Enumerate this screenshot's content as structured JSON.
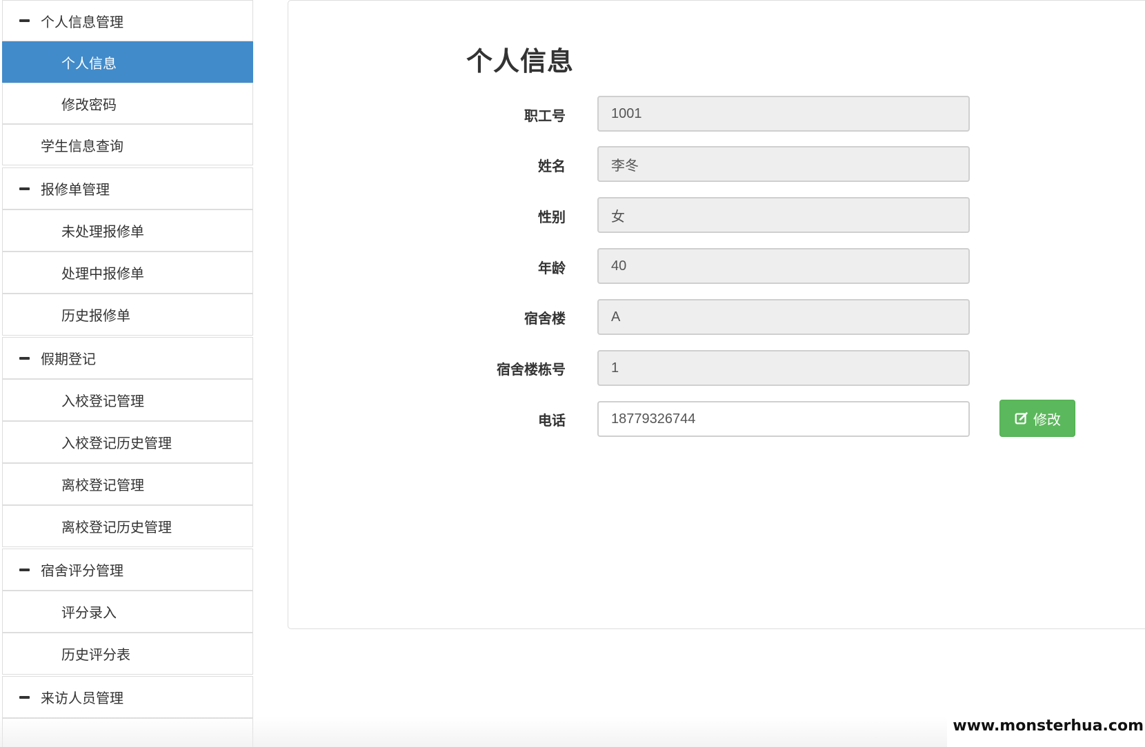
{
  "sidebar": {
    "items": [
      {
        "label": "个人信息管理",
        "kind": "group"
      },
      {
        "label": "个人信息",
        "kind": "sub",
        "active": true
      },
      {
        "label": "修改密码",
        "kind": "sub"
      },
      {
        "label": "学生信息查询",
        "kind": "plain"
      },
      {
        "label": "报修单管理",
        "kind": "group"
      },
      {
        "label": "未处理报修单",
        "kind": "sub"
      },
      {
        "label": "处理中报修单",
        "kind": "sub"
      },
      {
        "label": "历史报修单",
        "kind": "sub"
      },
      {
        "label": "假期登记",
        "kind": "group"
      },
      {
        "label": "入校登记管理",
        "kind": "sub"
      },
      {
        "label": "入校登记历史管理",
        "kind": "sub"
      },
      {
        "label": "离校登记管理",
        "kind": "sub"
      },
      {
        "label": "离校登记历史管理",
        "kind": "sub"
      },
      {
        "label": "宿舍评分管理",
        "kind": "group"
      },
      {
        "label": "评分录入",
        "kind": "sub"
      },
      {
        "label": "历史评分表",
        "kind": "sub"
      },
      {
        "label": "来访人员管理",
        "kind": "group"
      }
    ],
    "colors": {
      "active_bg": "#428bca",
      "active_text": "#ffffff"
    }
  },
  "main": {
    "title": "个人信息",
    "fields": [
      {
        "label": "职工号",
        "value": "1001",
        "readonly": true
      },
      {
        "label": "姓名",
        "value": "李冬",
        "readonly": true
      },
      {
        "label": "性别",
        "value": "女",
        "readonly": true
      },
      {
        "label": "年龄",
        "value": "40",
        "readonly": true
      },
      {
        "label": "宿舍楼",
        "value": "A",
        "readonly": true
      },
      {
        "label": "宿舍楼栋号",
        "value": "1",
        "readonly": true
      },
      {
        "label": "电话",
        "value": "18779326744",
        "readonly": false
      }
    ],
    "edit_button": {
      "label": "修改",
      "icon": "edit-icon",
      "color": "#5cb85c"
    }
  },
  "watermark": "www.monsterhua.com"
}
